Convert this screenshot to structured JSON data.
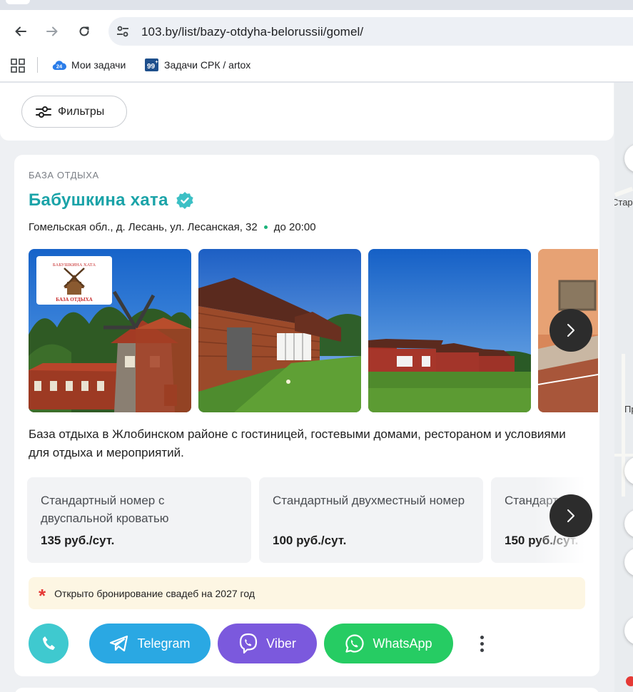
{
  "browser": {
    "url": "103.by/list/bazy-otdyha-belorussii/gomel/",
    "bookmarks": [
      {
        "label": "Мои задачи",
        "badge": "24"
      },
      {
        "label": "Задачи СРК / artox",
        "badge": "99"
      }
    ]
  },
  "filters": {
    "label": "Фильтры"
  },
  "map": {
    "labels": [
      "Стара",
      "Пр"
    ]
  },
  "listing": {
    "category": "БАЗА ОТДЫХА",
    "title": "Бабушкина хата",
    "address": "Гомельская обл., д. Лесань, ул. Лесанская, 32",
    "hours": "до 20:00",
    "logo_text": {
      "top": "БАБУШКИНА ХАТА",
      "bottom": "БАЗА ОТДЫХА"
    },
    "description": "База отдыха в Жлобинском районе с гостиницей, гостевыми домами, рестораном и условиями для отдыха и мероприятий.",
    "rooms": [
      {
        "name": "Стандартный номер с двуспальной кроватью",
        "price": "135 руб./сут."
      },
      {
        "name": "Стандартный двухместный номер",
        "price": "100 руб./сут."
      },
      {
        "name": "Стандартный т… номер",
        "price": "150 руб./сут."
      }
    ],
    "notice": "Открыто бронирование свадеб на 2027 год",
    "contacts": {
      "telegram": "Telegram",
      "viber": "Viber",
      "whatsapp": "WhatsApp"
    }
  },
  "colors": {
    "title": "#1aa3a8",
    "telegram": "#2aa8e3",
    "viber": "#7b59dd",
    "whatsapp": "#26cc63",
    "phone": "#3fc9cf",
    "notice_bg": "#fdf6e3"
  }
}
